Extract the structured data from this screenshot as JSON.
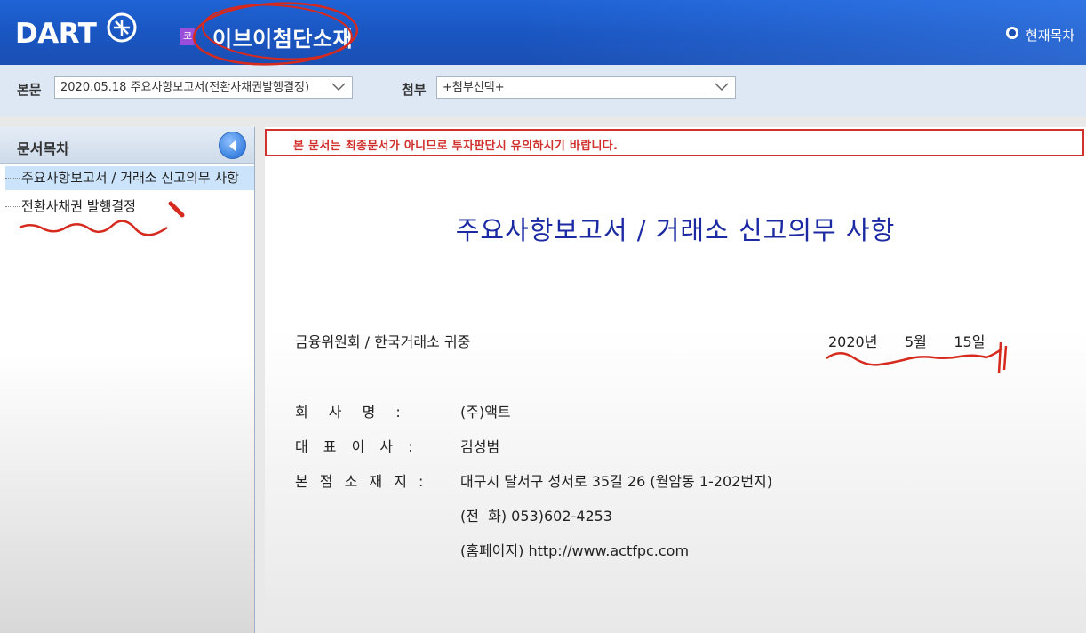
{
  "header": {
    "logo": "DART",
    "corp_badge": "코",
    "corp_name": "이브이첨단소재",
    "toc_link": "현재목차"
  },
  "selection": {
    "main_label": "본문",
    "main_value": "2020.05.18   주요사항보고서(전환사채권발행결정)",
    "attach_label": "첨부",
    "attach_value": "+첨부선택+"
  },
  "toc": {
    "title": "문서목차",
    "items": [
      {
        "label": "주요사항보고서 / 거래소 신고의무 사항"
      },
      {
        "label": "전환사채권 발행결정"
      }
    ]
  },
  "document": {
    "warning": "본 문서는 최종문서가 아니므로 투자판단시 유의하시기 바랍니다.",
    "title": "주요사항보고서 / 거래소 신고의무 사항",
    "addressee": "금융위원회 / 한국거래소 귀중",
    "date": "2020년      5월      15일",
    "rows": [
      {
        "label": "회 사 명 :",
        "value": "(주)액트"
      },
      {
        "label": "대 표 이 사 :",
        "value": "김성범"
      },
      {
        "label": "본 점 소 재 지 :",
        "value": "대구시 달서구 성서로 35길 26 (월암동 1-202번지)"
      },
      {
        "label": "",
        "value": "(전  화) 053)602-4253"
      },
      {
        "label": "",
        "value": "(홈페이지) http://www.actfpc.com"
      }
    ]
  },
  "colors": {
    "header_blue": "#1a55c0",
    "title_blue": "#1b2aa3",
    "warning_red": "#d0312d",
    "annotation_red": "#d62a1f"
  }
}
